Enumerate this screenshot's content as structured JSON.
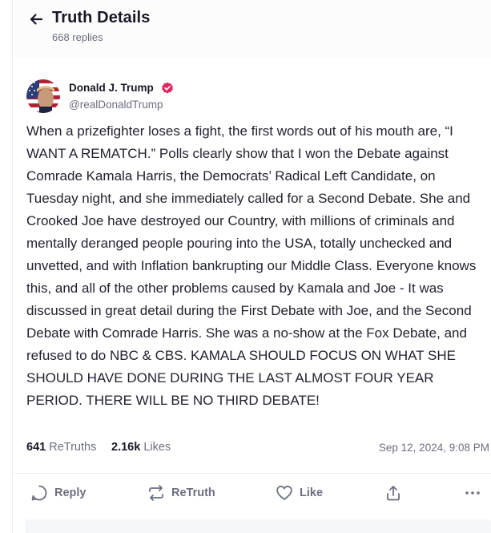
{
  "header": {
    "title": "Truth Details",
    "replies": "668 replies"
  },
  "post": {
    "author_name": "Donald J. Trump",
    "handle": "@realDonaldTrump",
    "body": "When a prizefighter loses a fight, the first words out of his mouth are, “I WANT A REMATCH.” Polls clearly show that I won the Debate against Comrade Kamala Harris, the Democrats’ Radical Left Candidate, on Tuesday night, and she immediately called for a Second Debate. She and Crooked Joe have destroyed our Country, with millions of criminals and mentally deranged people pouring into the USA, totally unchecked and unvetted, and with Inflation bankrupting our Middle Class. Everyone knows this, and all of the other problems caused by Kamala and Joe - It was discussed in great detail during the First Debate with Joe, and the Second Debate with Comrade Harris. She was a no-show at the Fox Debate, and refused to do NBC & CBS. KAMALA SHOULD FOCUS ON WHAT SHE SHOULD HAVE DONE DURING THE LAST ALMOST FOUR YEAR PERIOD. THERE WILL BE NO THIRD DEBATE!",
    "retruths_count": "641",
    "retruths_label": "ReTruths",
    "likes_count": "2.16k",
    "likes_label": "Likes",
    "timestamp": "Sep 12, 2024, 9:08 PM"
  },
  "actions": {
    "reply_label": "Reply",
    "retruth_label": "ReTruth",
    "like_label": "Like"
  },
  "colors": {
    "accent_verified": "#e0245e",
    "muted_text": "#6b6f80",
    "primary_text": "#171727"
  },
  "icons": [
    "arrow-left-icon",
    "verified-badge-icon",
    "reply-bubble-icon",
    "retruth-arrows-icon",
    "heart-icon",
    "share-upload-icon",
    "more-dots-icon"
  ]
}
